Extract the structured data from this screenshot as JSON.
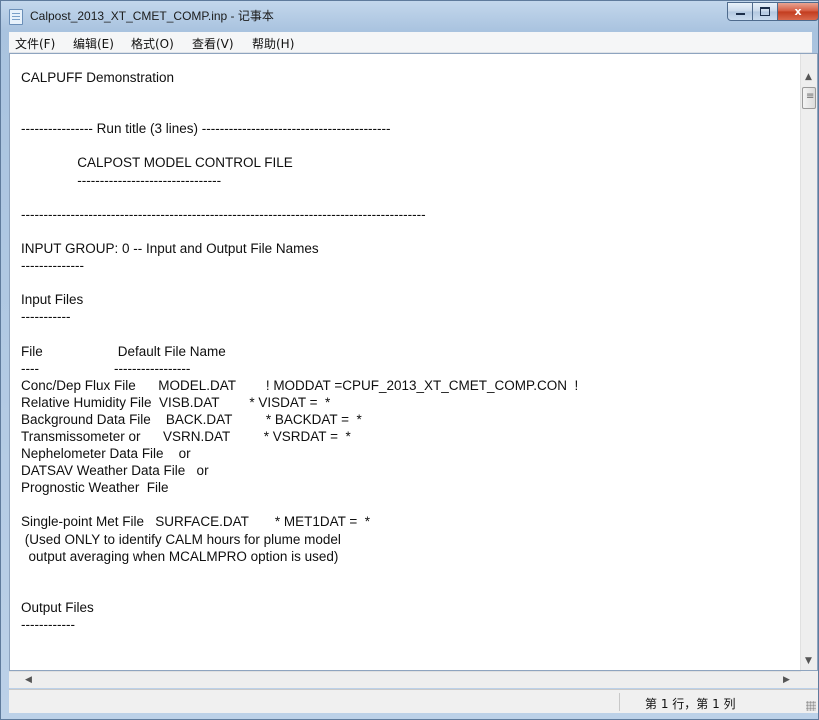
{
  "window": {
    "title": "Calpost_2013_XT_CMET_COMP.inp - 记事本",
    "icon": "notepad-icon",
    "controls": {
      "minimize": "minimize-icon",
      "maximize": "maximize-icon",
      "close_label": "x"
    }
  },
  "menu": [
    "文件(F)",
    "编辑(E)",
    "格式(O)",
    "查看(V)",
    "帮助(H)"
  ],
  "document": {
    "lines": [
      "CALPUFF Demonstration",
      "",
      "",
      "---------------- Run title (3 lines) ------------------------------------------",
      "",
      "               CALPOST MODEL CONTROL FILE",
      "               --------------------------------",
      "",
      "------------------------------------------------------------------------------------------",
      "",
      "INPUT GROUP: 0 -- Input and Output File Names",
      "--------------",
      "",
      "Input Files",
      "-----------",
      "",
      "File                    Default File Name",
      "----                    -----------------",
      "Conc/Dep Flux File      MODEL.DAT        ! MODDAT =CPUF_2013_XT_CMET_COMP.CON  !",
      "Relative Humidity File  VISB.DAT        * VISDAT =  *",
      "Background Data File    BACK.DAT         * BACKDAT =  *",
      "Transmissometer or      VSRN.DAT         * VSRDAT =  *",
      "Nephelometer Data File    or",
      "DATSAV Weather Data File   or",
      "Prognostic Weather  File",
      "",
      "Single-point Met File   SURFACE.DAT       * MET1DAT =  *",
      " (Used ONLY to identify CALM hours for plume model",
      "  output averaging when MCALMPRO option is used)",
      "",
      "",
      "Output Files",
      "------------"
    ]
  },
  "status": {
    "position": "第 1 行，第 1 列"
  },
  "colors": {
    "title_bar": "#b6cde6",
    "close_button": "#c9432a",
    "editor_bg": "#ffffff"
  }
}
